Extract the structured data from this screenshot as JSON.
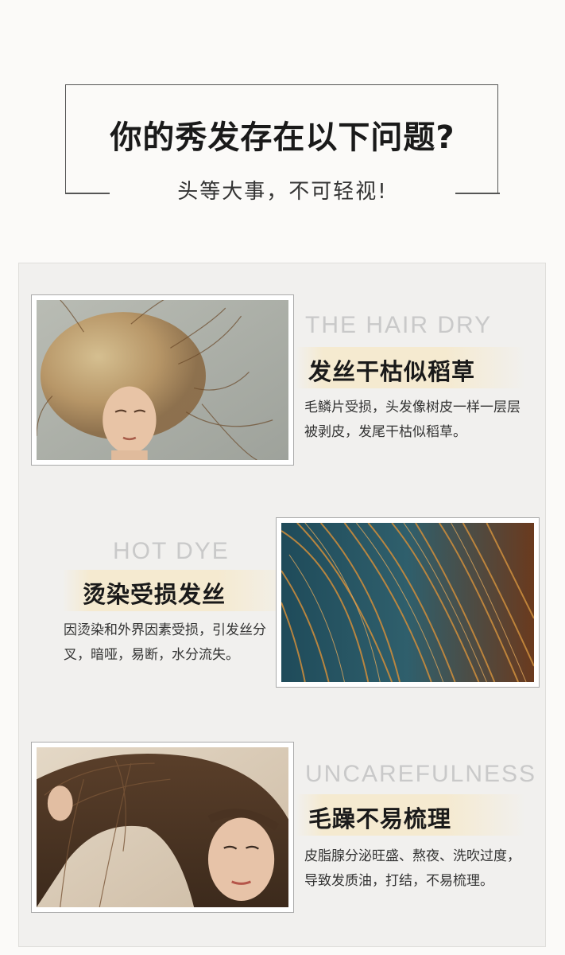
{
  "header": {
    "title": "你的秀发存在以下问题?",
    "subtitle": "头等大事，不可轻视!"
  },
  "items": [
    {
      "en": "THE HAIR DRY",
      "cn": "发丝干枯似稻草",
      "desc": "毛鳞片受损，头发像树皮一样一层层被剥皮，发尾干枯似稻草。",
      "image": "photo-frizzy-blonde-hair-girl"
    },
    {
      "en": "HOT DYE",
      "cn": "烫染受损发丝",
      "desc": "因烫染和外界因素受损，引发丝分叉，暗哑，易断，水分流失。",
      "image": "photo-split-ends-closeup"
    },
    {
      "en": "UNCAREFULNESS",
      "cn": "毛躁不易梳理",
      "desc": "皮脂腺分泌旺盛、熬夜、洗吹过度，导致发质油，打结，不易梳理。",
      "image": "photo-woman-tangled-hair"
    }
  ],
  "colors": {
    "band": "#f5ead0",
    "english": "#c9c9c9",
    "panel": "#f1f0ee"
  }
}
